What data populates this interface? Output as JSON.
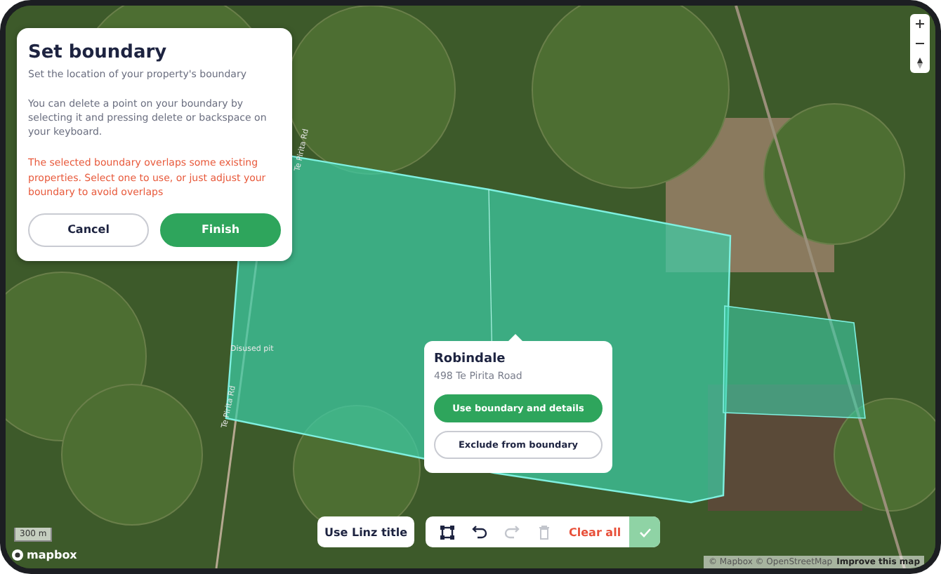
{
  "panel": {
    "title": "Set boundary",
    "subtitle": "Set the location of your property's boundary",
    "info": "You can delete a point on your boundary by selecting it and pressing delete or backspace on your keyboard.",
    "warning": "The selected boundary overlaps some existing properties. Select one to use, or just adjust your boundary to avoid overlaps",
    "buttons": [
      {
        "label": "Cancel",
        "kind": "secondary"
      },
      {
        "label": "Finish",
        "kind": "primary"
      }
    ]
  },
  "popup": {
    "name": "Robindale",
    "address": "498 Te Pirita Road",
    "buttons": [
      {
        "label": "Use boundary and details",
        "kind": "primary"
      },
      {
        "label": "Exclude from boundary",
        "kind": "secondary"
      }
    ]
  },
  "toolbar": {
    "linz_label": "Use Linz title",
    "tools": [
      {
        "kind": "polygon",
        "disabled": false
      },
      {
        "kind": "undo",
        "disabled": false
      },
      {
        "kind": "redo",
        "disabled": true
      },
      {
        "kind": "delete",
        "disabled": true
      }
    ],
    "clear_label": "Clear all",
    "confirm_disabled": true
  },
  "map": {
    "labels": [
      {
        "text": "Disused pit",
        "kind": "poi"
      },
      {
        "text": "Te Pirita Rd",
        "kind": "road"
      },
      {
        "text": "Te Pirita Rd",
        "kind": "road"
      }
    ],
    "scale": "300 m",
    "logo": "mapbox",
    "attribution": "© Mapbox © OpenStreetMap",
    "improve_link": "Improve this map"
  }
}
